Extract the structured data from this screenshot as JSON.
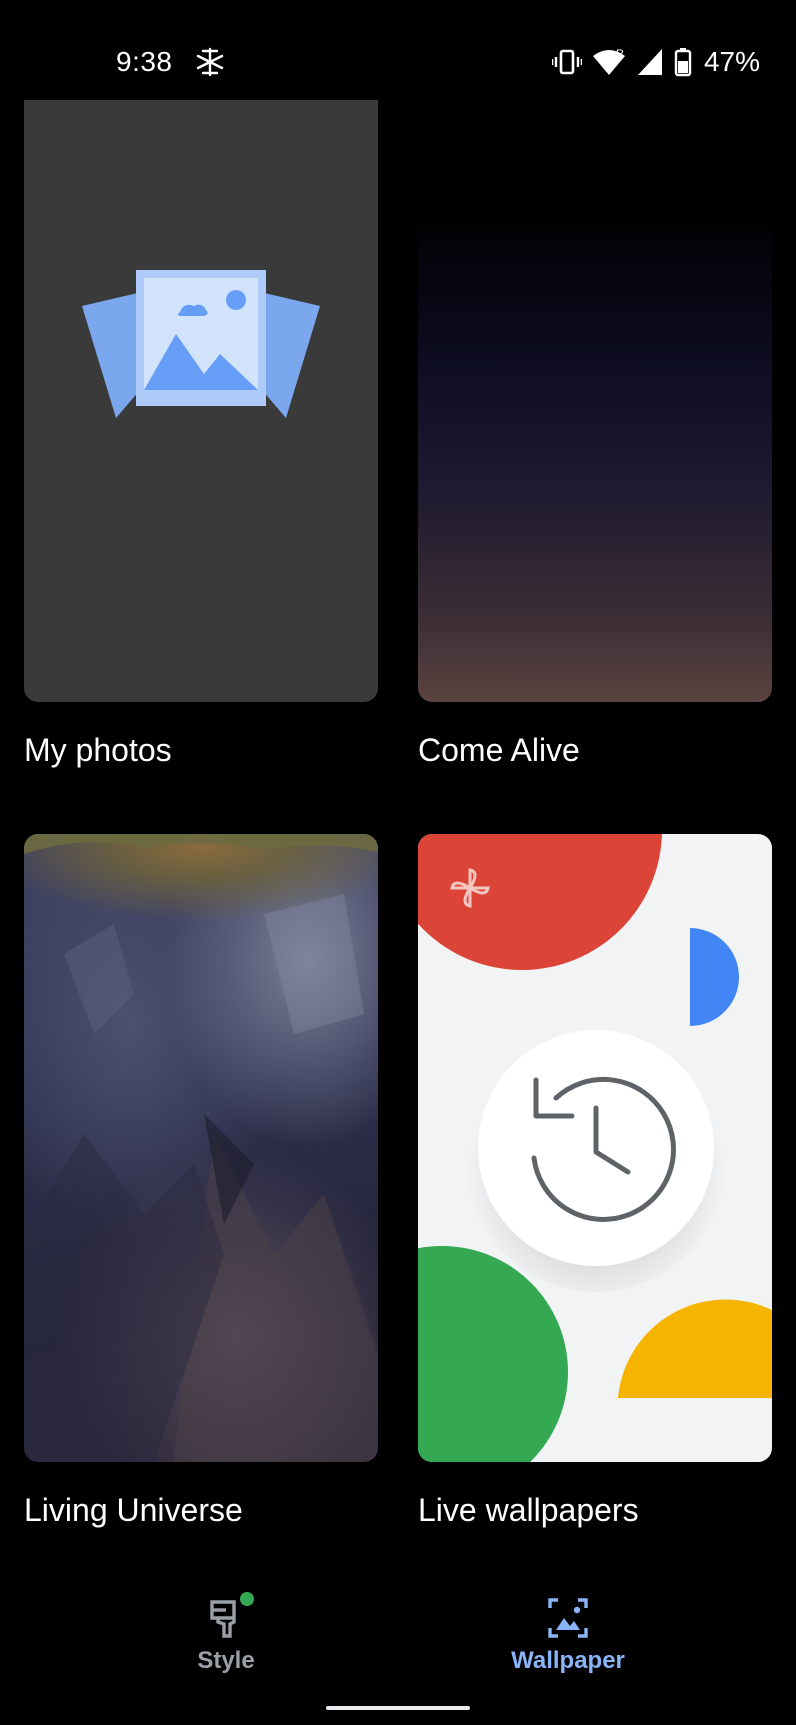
{
  "status_bar": {
    "time": "9:38",
    "left_icon": "sparkle-icon",
    "icons": [
      "vibrate-icon",
      "wifi-icon",
      "signal-icon",
      "battery-icon"
    ],
    "roaming_indicator": "R",
    "battery": "47%"
  },
  "tiles": [
    {
      "label": "My photos",
      "icon": "photos-icon"
    },
    {
      "label": "Come Alive"
    },
    {
      "label": "Living Universe"
    },
    {
      "label": "Live wallpapers",
      "icon": "history-icon"
    }
  ],
  "bottom_nav": {
    "items": [
      {
        "label": "Style",
        "icon": "style-brush-icon",
        "selected": false,
        "badge": true
      },
      {
        "label": "Wallpaper",
        "icon": "wallpaper-icon",
        "selected": true
      }
    ]
  },
  "colors": {
    "accent": "#8ab4f8",
    "badge": "#34a853",
    "google_red": "#db4437",
    "google_blue": "#4285f4",
    "google_green": "#0f9d58",
    "google_yellow": "#f4b400"
  }
}
